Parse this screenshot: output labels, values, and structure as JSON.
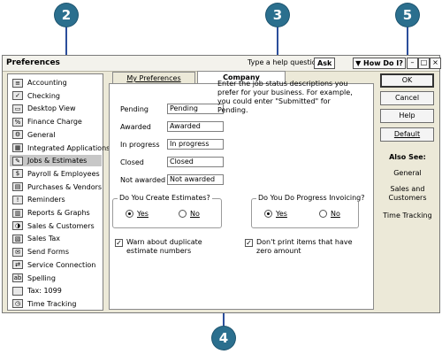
{
  "callouts": {
    "c2": "2",
    "c3": "3",
    "c5": "5",
    "c4": "4"
  },
  "window": {
    "title": "Preferences",
    "help_label": "Type a help question",
    "ask_label": "Ask",
    "how_do_label": "▼ How Do I?",
    "min_glyph": "–",
    "max_glyph": "□",
    "close_glyph": "×"
  },
  "categories": [
    {
      "label": "Accounting",
      "icon": "accounting-icon"
    },
    {
      "label": "Checking",
      "icon": "checking-icon"
    },
    {
      "label": "Desktop View",
      "icon": "desktop-view-icon"
    },
    {
      "label": "Finance Charge",
      "icon": "finance-charge-icon"
    },
    {
      "label": "General",
      "icon": "general-icon"
    },
    {
      "label": "Integrated Applications",
      "icon": "integrated-applications-icon"
    },
    {
      "label": "Jobs & Estimates",
      "icon": "jobs-estimates-icon"
    },
    {
      "label": "Payroll & Employees",
      "icon": "payroll-employees-icon"
    },
    {
      "label": "Purchases & Vendors",
      "icon": "purchases-vendors-icon"
    },
    {
      "label": "Reminders",
      "icon": "reminders-icon"
    },
    {
      "label": "Reports & Graphs",
      "icon": "reports-graphs-icon"
    },
    {
      "label": "Sales & Customers",
      "icon": "sales-customers-icon"
    },
    {
      "label": "Sales Tax",
      "icon": "sales-tax-icon"
    },
    {
      "label": "Send Forms",
      "icon": "send-forms-icon"
    },
    {
      "label": "Service Connection",
      "icon": "service-connection-icon"
    },
    {
      "label": "Spelling",
      "icon": "spelling-icon"
    },
    {
      "label": "Tax: 1099",
      "icon": "tax-1099-icon"
    },
    {
      "label": "Time Tracking",
      "icon": "time-tracking-icon"
    }
  ],
  "selected_category": "Jobs & Estimates",
  "tabs": {
    "my": "My Preferences",
    "company": "Company Preferences"
  },
  "fields": {
    "pending": {
      "label": "Pending",
      "value": "Pending"
    },
    "awarded": {
      "label": "Awarded",
      "value": "Awarded"
    },
    "in_progress": {
      "label": "In progress",
      "value": "In progress"
    },
    "closed": {
      "label": "Closed",
      "value": "Closed"
    },
    "not_awarded": {
      "label": "Not awarded",
      "value": "Not awarded"
    }
  },
  "description": "Enter the job status descriptions you prefer for your business. For example, you could enter \"Submitted\" for Pending.",
  "estimates_group": {
    "title": "Do You Create Estimates?",
    "yes": "Yes",
    "no": "No",
    "selected": "Yes"
  },
  "progress_group": {
    "title": "Do You Do Progress Invoicing?",
    "yes": "Yes",
    "no": "No",
    "selected": "Yes"
  },
  "checkboxes": {
    "warn_duplicate": {
      "label": "Warn about duplicate estimate numbers",
      "checked": true
    },
    "dont_print_zero": {
      "label": "Don't print items that have zero amount",
      "checked": true
    }
  },
  "buttons": {
    "ok": "OK",
    "cancel": "Cancel",
    "help": "Help",
    "default": "Default"
  },
  "also_see": {
    "heading": "Also See:",
    "items": [
      "General",
      "Sales and Customers",
      "Time Tracking"
    ]
  },
  "colors": {
    "callout": "#2b6f8e",
    "callout_line": "#2b4e9b",
    "dialog_bg": "#ece9d8"
  }
}
